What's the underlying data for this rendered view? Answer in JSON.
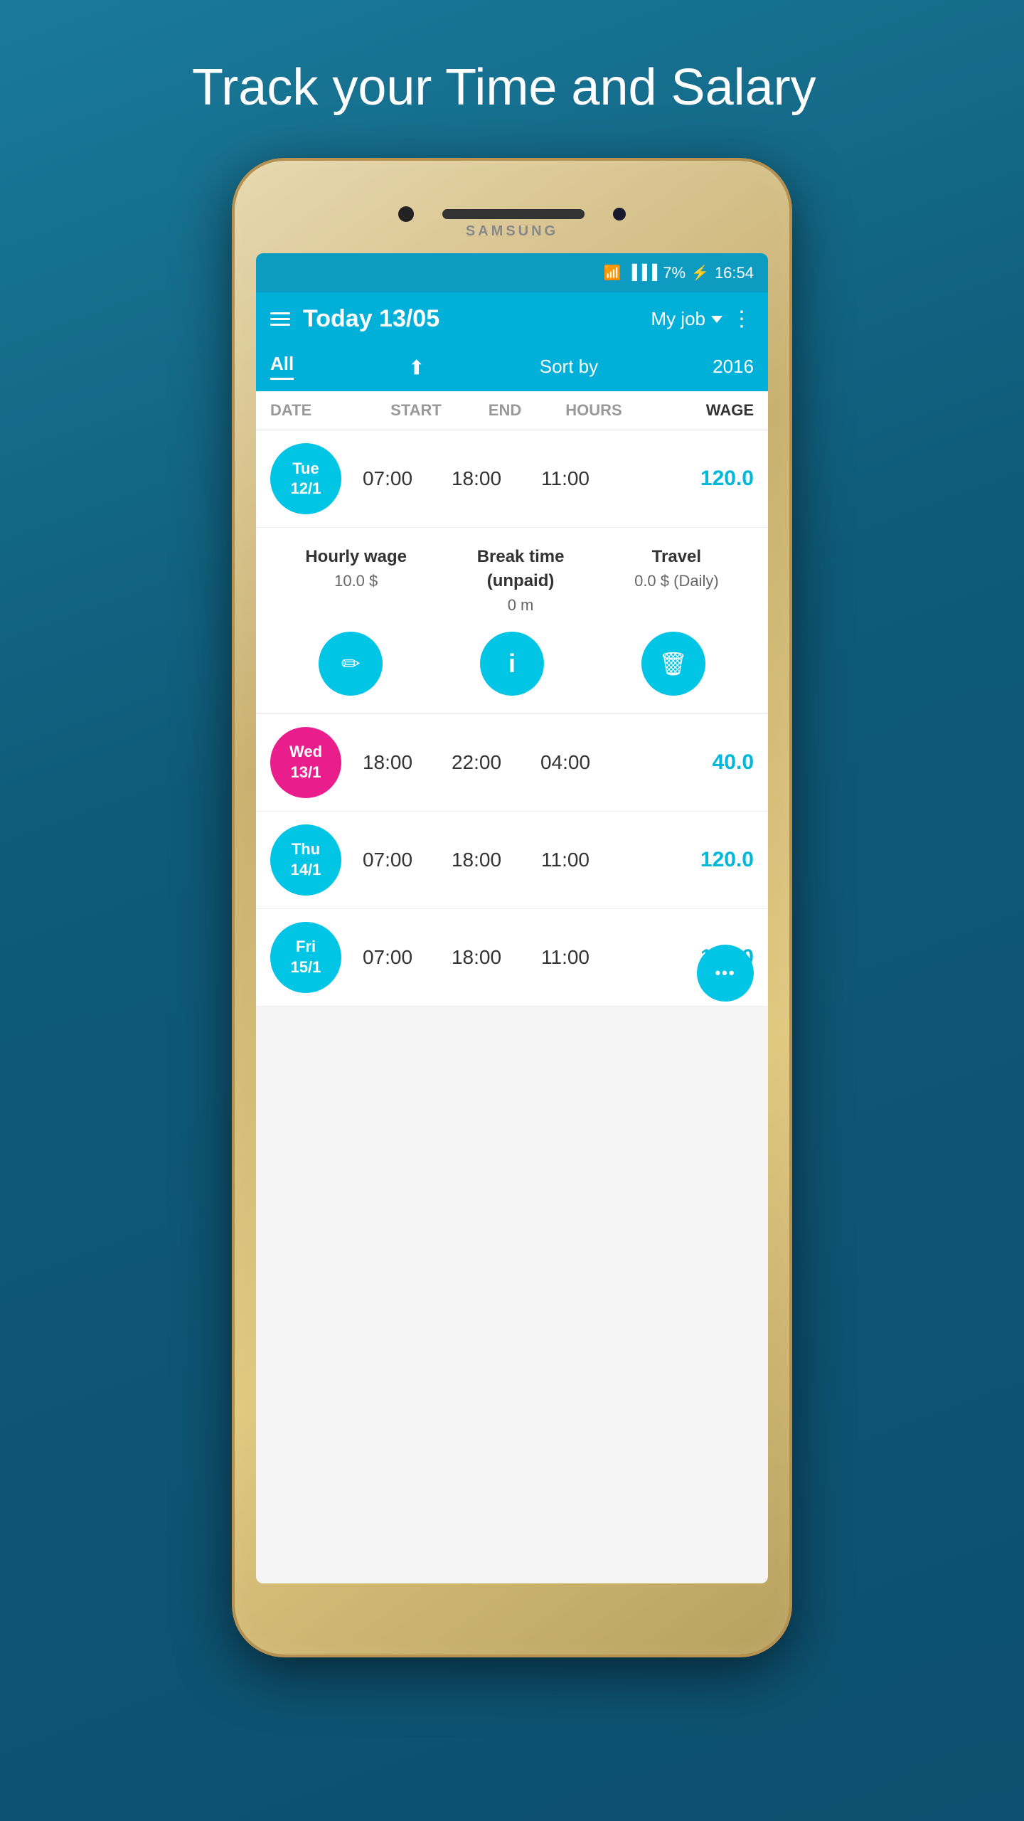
{
  "hero": {
    "title": "Track your Time and Salary"
  },
  "status_bar": {
    "wifi": "WiFi",
    "signal": "Signal",
    "battery": "7%",
    "charging": true,
    "time": "16:54"
  },
  "app_header": {
    "menu_icon": "hamburger-icon",
    "title": "Today 13/05",
    "job_name": "My job",
    "more_icon": "more-icon"
  },
  "filter_bar": {
    "filter_all_label": "All",
    "sort_icon": "sort-icon",
    "sort_label": "Sort by",
    "year": "2016"
  },
  "table_header": {
    "col_date": "DATE",
    "col_start": "START",
    "col_end": "END",
    "col_hours": "HOURS",
    "col_wage": "WAGE"
  },
  "rows": [
    {
      "day": "Tue",
      "date": "12/1",
      "color": "blue",
      "start": "07:00",
      "end": "18:00",
      "hours": "11:00",
      "wage": "120.0",
      "expanded": true
    },
    {
      "day": "Wed",
      "date": "13/1",
      "color": "pink",
      "start": "18:00",
      "end": "22:00",
      "hours": "04:00",
      "wage": "40.0",
      "expanded": false
    },
    {
      "day": "Thu",
      "date": "14/1",
      "color": "blue",
      "start": "07:00",
      "end": "18:00",
      "hours": "11:00",
      "wage": "120.0",
      "expanded": false
    },
    {
      "day": "Fri",
      "date": "15/1",
      "color": "blue",
      "start": "07:00",
      "end": "18:00",
      "hours": "11:00",
      "wage": "120.0",
      "expanded": false,
      "partial": true
    }
  ],
  "detail": {
    "hourly_wage_label": "Hourly wage",
    "hourly_wage_value": "10.0 $",
    "break_label": "Break time\n(unpaid)",
    "break_value": "0 m",
    "travel_label": "Travel",
    "travel_value": "0.0 $ (Daily)",
    "edit_icon": "edit-icon",
    "info_icon": "info-icon",
    "delete_icon": "delete-icon"
  },
  "phone": {
    "brand": "SAMSUNG"
  }
}
